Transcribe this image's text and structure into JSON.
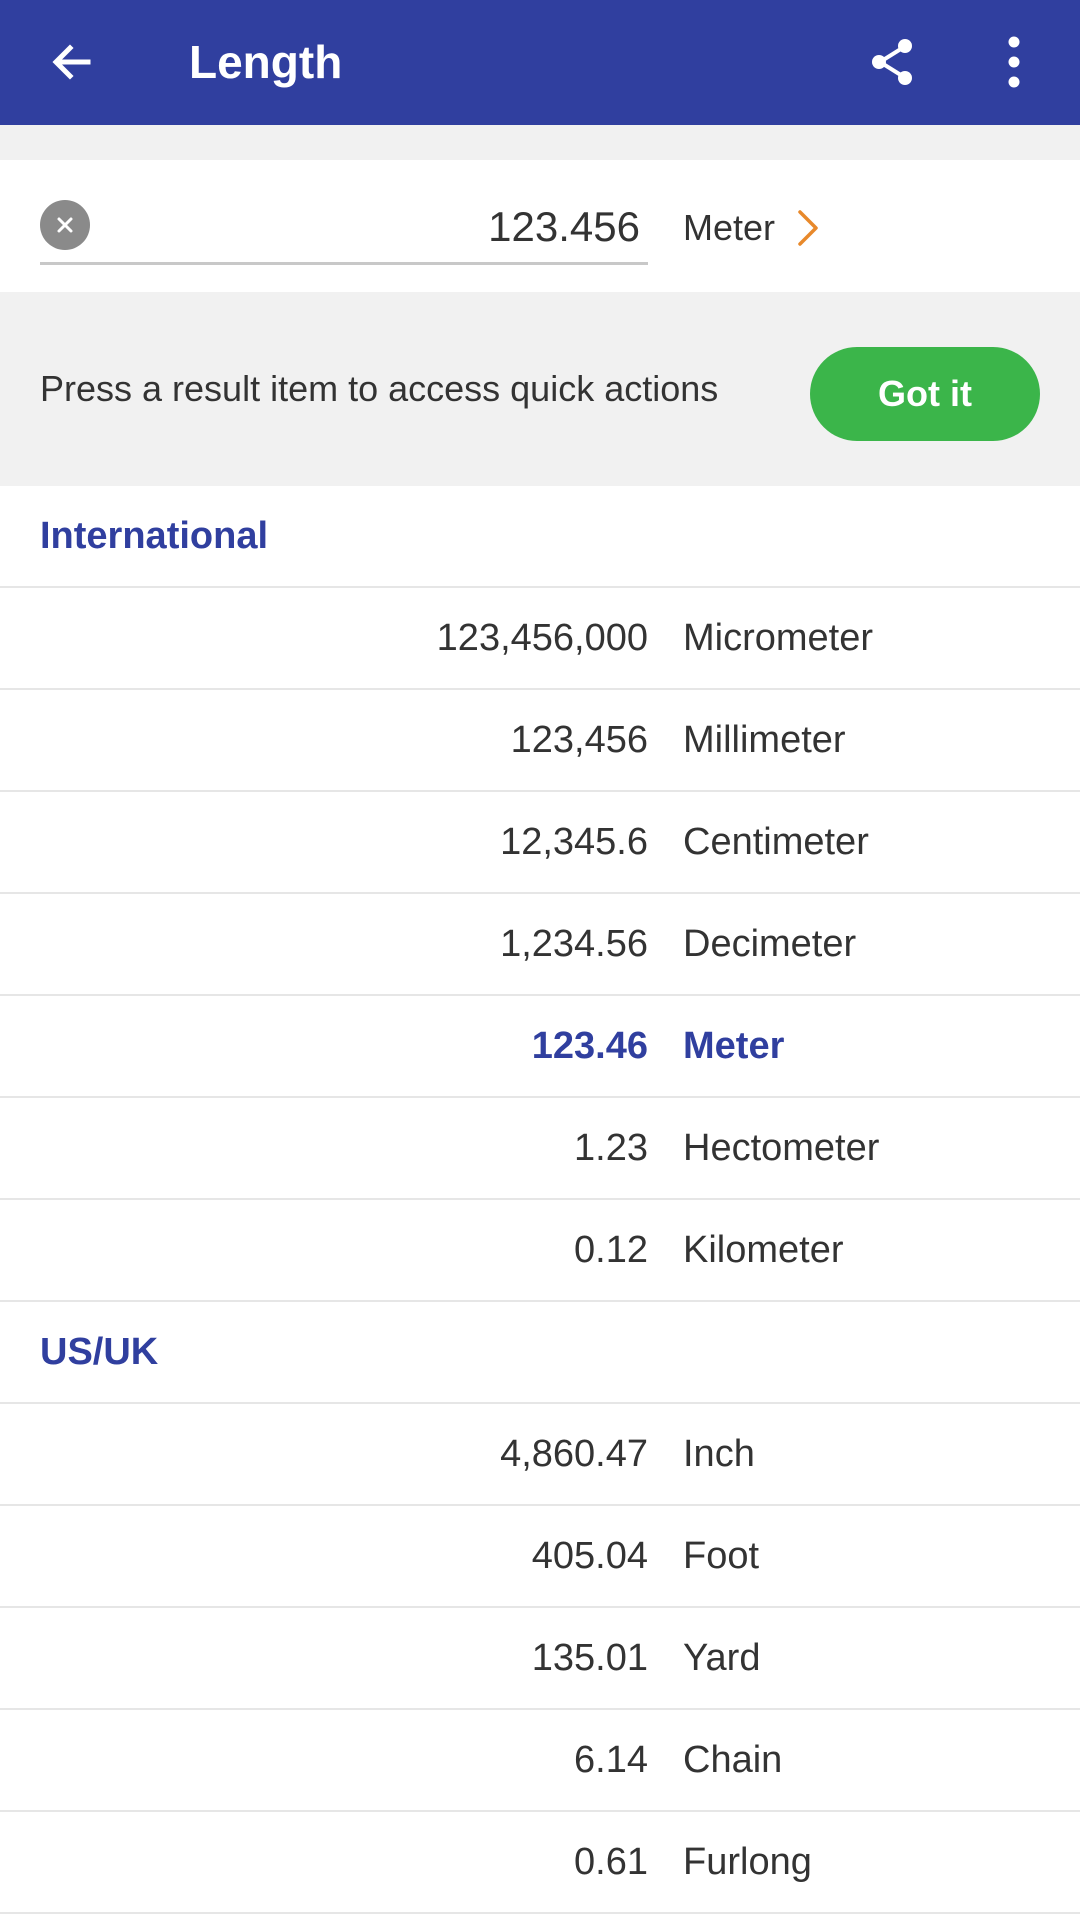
{
  "app_bar": {
    "title": "Length",
    "back_icon": "arrow-left-icon",
    "share_icon": "share-icon",
    "more_icon": "more-vertical-icon",
    "background": "#303f9f"
  },
  "input": {
    "value": "123.456",
    "unit": "Meter",
    "clear_icon": "close-icon",
    "chevron_icon": "chevron-right-icon",
    "chevron_color": "#e8892b"
  },
  "hint": {
    "text": "Press a result item to access quick actions",
    "button_label": "Got it",
    "button_color": "#3bb54a"
  },
  "sections": [
    {
      "header": "International",
      "rows": [
        {
          "value": "123,456,000",
          "unit": "Micrometer"
        },
        {
          "value": "123,456",
          "unit": "Millimeter"
        },
        {
          "value": "12,345.6",
          "unit": "Centimeter"
        },
        {
          "value": "1,234.56",
          "unit": "Decimeter"
        },
        {
          "value": "123.46",
          "unit": "Meter",
          "selected": true
        },
        {
          "value": "1.23",
          "unit": "Hectometer"
        },
        {
          "value": "0.12",
          "unit": "Kilometer"
        }
      ]
    },
    {
      "header": "US/UK",
      "rows": [
        {
          "value": "4,860.47",
          "unit": "Inch"
        },
        {
          "value": "405.04",
          "unit": "Foot"
        },
        {
          "value": "135.01",
          "unit": "Yard"
        },
        {
          "value": "6.14",
          "unit": "Chain"
        },
        {
          "value": "0.61",
          "unit": "Furlong"
        }
      ]
    }
  ],
  "colors": {
    "accent": "#303f9f",
    "banner_bg": "#f1f1f1"
  }
}
